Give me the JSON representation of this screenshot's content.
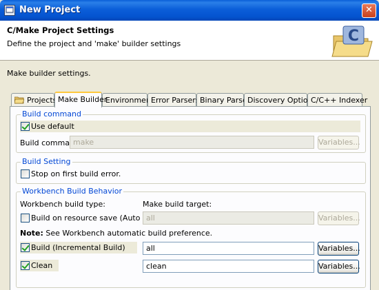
{
  "window": {
    "title": "New Project"
  },
  "header": {
    "title": "C/Make Project Settings",
    "description": "Define the project and 'make' builder settings"
  },
  "section_description": "Make builder settings.",
  "tabs": [
    {
      "label": "Projects",
      "icon": "folder-icon",
      "active": false
    },
    {
      "label": "Make Builder",
      "active": true
    },
    {
      "label": "Environment",
      "active": false
    },
    {
      "label": "Error Parsers",
      "active": false
    },
    {
      "label": "Binary Parser",
      "active": false
    },
    {
      "label": "Discovery Options",
      "active": false
    },
    {
      "label": "C/C++ Indexer",
      "active": false
    }
  ],
  "build_command": {
    "legend": "Build command",
    "use_default_label": "Use default",
    "use_default_checked": true,
    "command_label": "Build command:",
    "command_value": "make",
    "variables_label": "Variables..."
  },
  "build_setting": {
    "legend": "Build Setting",
    "stop_on_error_label": "Stop on first build error.",
    "stop_on_error_checked": false
  },
  "workbench": {
    "legend": "Workbench Build Behavior",
    "type_label": "Workbench build type:",
    "target_label": "Make build target:",
    "auto_build_label": "Build on resource save (Auto Build)",
    "auto_build_checked": false,
    "auto_build_target": "all",
    "note_prefix": "Note:",
    "note_text": "See Workbench automatic build preference.",
    "incremental_label": "Build (Incremental Build)",
    "incremental_checked": true,
    "incremental_target": "all",
    "clean_label": "Clean",
    "clean_checked": true,
    "clean_target": "clean",
    "variables_label": "Variables..."
  },
  "colors": {
    "accent": "#0046d5",
    "titlebar": "#0454d0",
    "tab_highlight": "#ffc83c"
  }
}
